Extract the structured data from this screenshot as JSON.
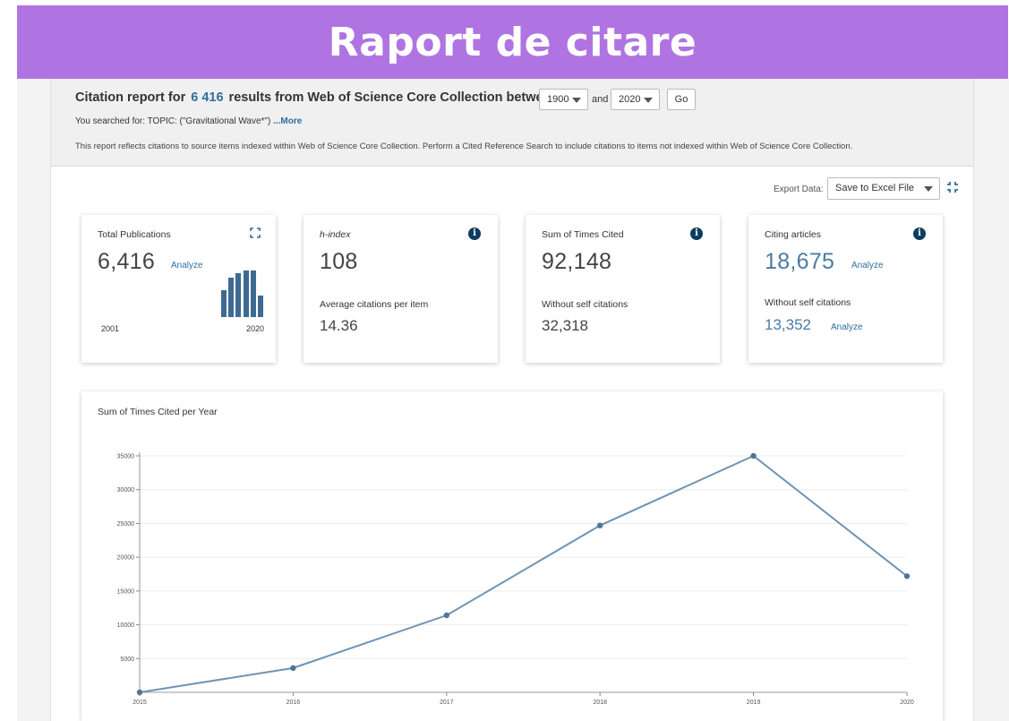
{
  "banner": {
    "title": "Raport de citare"
  },
  "header": {
    "title_prefix": "Citation report for",
    "result_count": "6 416",
    "title_suffix": "results from Web of Science Core Collection between",
    "year_from": "1900",
    "and_label": "and",
    "year_to": "2020",
    "go_label": "Go",
    "searched_prefix": "You searched for: TOPIC: (\"Gravitational Wave*\")",
    "more_label": "...More",
    "reflects_text": "This report reflects citations to source items indexed within Web of Science Core Collection. Perform a Cited Reference Search to include citations to items not indexed within Web of Science Core Collection."
  },
  "export": {
    "label": "Export Data:",
    "selected": "Save to Excel File"
  },
  "cards": {
    "total_publications": {
      "label": "Total Publications",
      "value": "6,416",
      "analyze": "Analyze",
      "year_start": "2001",
      "year_end": "2020",
      "spark_values": [
        0.58,
        0.84,
        0.94,
        1.0,
        1.0,
        0.46
      ]
    },
    "h_index": {
      "label": "h-index",
      "value": "108",
      "sub_label": "Average citations per item",
      "sub_value": "14.36"
    },
    "sum_times_cited": {
      "label": "Sum of Times Cited",
      "value": "92,148",
      "sub_label": "Without self citations",
      "sub_value": "32,318"
    },
    "citing_articles": {
      "label": "Citing articles",
      "value": "18,675",
      "analyze": "Analyze",
      "sub_label": "Without self citations",
      "sub_value": "13,352",
      "sub_analyze": "Analyze"
    }
  },
  "colors": {
    "banner": "#b074e2",
    "accent": "#2e6e9e",
    "line": "#7093b3",
    "bar": "#3d6a93"
  },
  "chart_data": {
    "type": "line",
    "title": "Sum of Times Cited per Year",
    "xlabel": "",
    "ylabel": "",
    "categories": [
      "2015",
      "2016",
      "2017",
      "2018",
      "2019",
      "2020"
    ],
    "values": [
      0,
      3600,
      11400,
      24700,
      35000,
      17200
    ],
    "ylim": [
      0,
      35000
    ],
    "yticks": [
      5000,
      10000,
      15000,
      20000,
      25000,
      30000,
      35000
    ],
    "grid": true,
    "legend": "none"
  }
}
